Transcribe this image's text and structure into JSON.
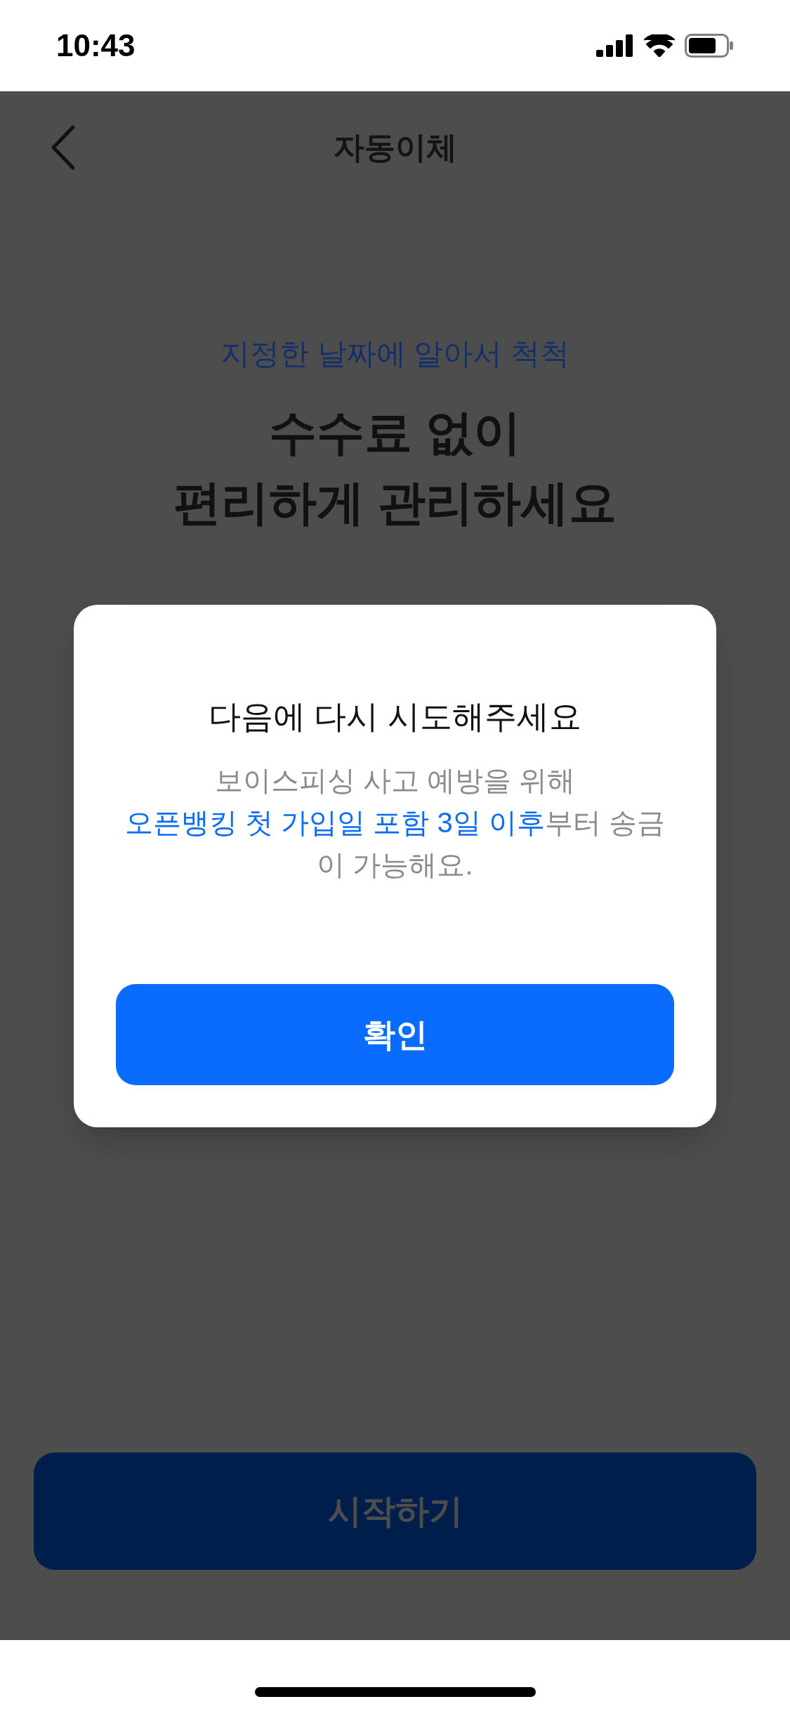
{
  "status_bar": {
    "time": "10:43"
  },
  "header": {
    "title": "자동이체"
  },
  "hero": {
    "subtitle": "지정한 날짜에 알아서 척척",
    "headline": [
      "수수료 없이",
      "편리하게 관리하세요"
    ]
  },
  "primary_button": {
    "label": "시작하기",
    "disabled": true
  },
  "dialog": {
    "title": "다음에 다시 시도해주세요",
    "message": [
      {
        "text": "보이스피싱 사고 예방을 위해\n",
        "highlight": false
      },
      {
        "text": "오픈뱅킹 첫 가입일 포함 3일 이후",
        "highlight": true
      },
      {
        "text": "부터 송금이 가능해요.",
        "highlight": false
      }
    ],
    "button": "확인"
  }
}
